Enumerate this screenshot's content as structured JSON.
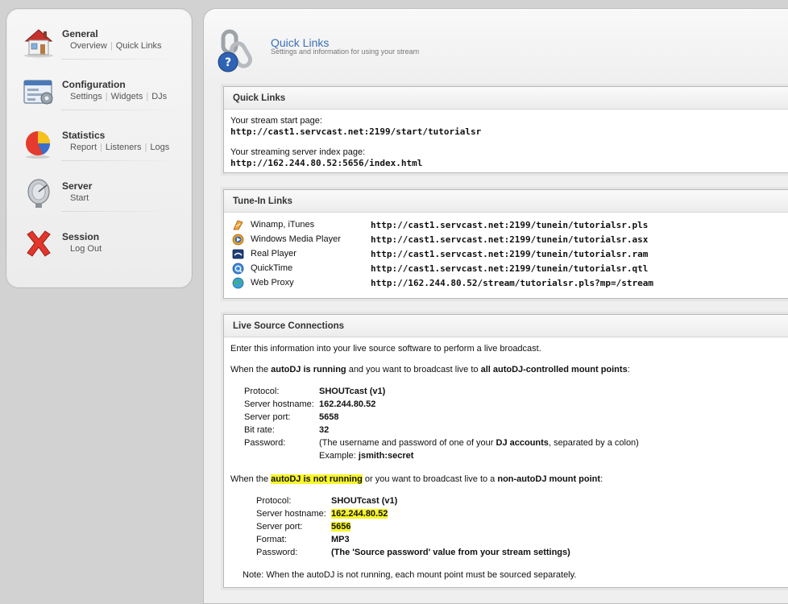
{
  "sidebar": {
    "sections": [
      {
        "title": "General",
        "links": [
          "Overview",
          "Quick Links"
        ]
      },
      {
        "title": "Configuration",
        "links": [
          "Settings",
          "Widgets",
          "DJs"
        ]
      },
      {
        "title": "Statistics",
        "links": [
          "Report",
          "Listeners",
          "Logs"
        ]
      },
      {
        "title": "Server",
        "links": [
          "Start"
        ]
      },
      {
        "title": "Session",
        "links": [
          "Log Out"
        ]
      }
    ]
  },
  "header": {
    "title": "Quick Links",
    "subtitle": "Settings and information for using your stream"
  },
  "quick_links": {
    "heading": "Quick Links",
    "start_label": "Your stream start page:",
    "start_url": "http://cast1.servcast.net:2199/start/tutorialsr",
    "index_label": "Your streaming server index page:",
    "index_url": "http://162.244.80.52:5656/index.html"
  },
  "tunein": {
    "heading": "Tune-In Links",
    "rows": [
      {
        "name": "Winamp, iTunes",
        "url": "http://cast1.servcast.net:2199/tunein/tutorialsr.pls",
        "icon": "winamp-icon"
      },
      {
        "name": "Windows Media Player",
        "url": "http://cast1.servcast.net:2199/tunein/tutorialsr.asx",
        "icon": "windows-media-icon"
      },
      {
        "name": "Real Player",
        "url": "http://cast1.servcast.net:2199/tunein/tutorialsr.ram",
        "icon": "realplayer-icon"
      },
      {
        "name": "QuickTime",
        "url": "http://cast1.servcast.net:2199/tunein/tutorialsr.qtl",
        "icon": "quicktime-icon"
      },
      {
        "name": "Web Proxy",
        "url": "http://162.244.80.52/stream/tutorialsr.pls?mp=/stream",
        "icon": "globe-icon"
      }
    ]
  },
  "live": {
    "heading": "Live Source Connections",
    "intro": "Enter this information into your live source software to perform a live broadcast.",
    "autodj_running": {
      "p1": "When the ",
      "b1": "autoDJ is running",
      "p2": " and you want to broadcast live to ",
      "b2": "all autoDJ-controlled mount points",
      "p3": ":",
      "protocol_label": "Protocol:",
      "protocol": "SHOUTcast (v1)",
      "host_label": "Server hostname:",
      "host": "162.244.80.52",
      "port_label": "Server port:",
      "port": "5658",
      "bitrate_label": "Bit rate:",
      "bitrate": "32",
      "password_label": "Password:",
      "password_p1": "(The username and password of one of your ",
      "password_b": "DJ accounts",
      "password_p2": ", separated by a colon)",
      "example_label": "Example: ",
      "example": "jsmith:secret"
    },
    "autodj_not_running": {
      "p1": "When the ",
      "b1": "autoDJ is not running",
      "p2": " or you want to broadcast live to a ",
      "b2": "non-autoDJ mount point",
      "p3": ":",
      "protocol_label": "Protocol:",
      "protocol": "SHOUTcast (v1)",
      "host_label": "Server hostname:",
      "host": "162.244.80.52",
      "port_label": "Server port:",
      "port": "5656",
      "format_label": "Format:",
      "format": "MP3",
      "password_label": "Password:",
      "password": "(The 'Source password' value from your stream settings)"
    },
    "note": "Note: When the autoDJ is not running, each mount point must be sourced separately."
  },
  "colors": {
    "accent_link": "#3c6fb8",
    "highlight": "#f8f62a"
  }
}
